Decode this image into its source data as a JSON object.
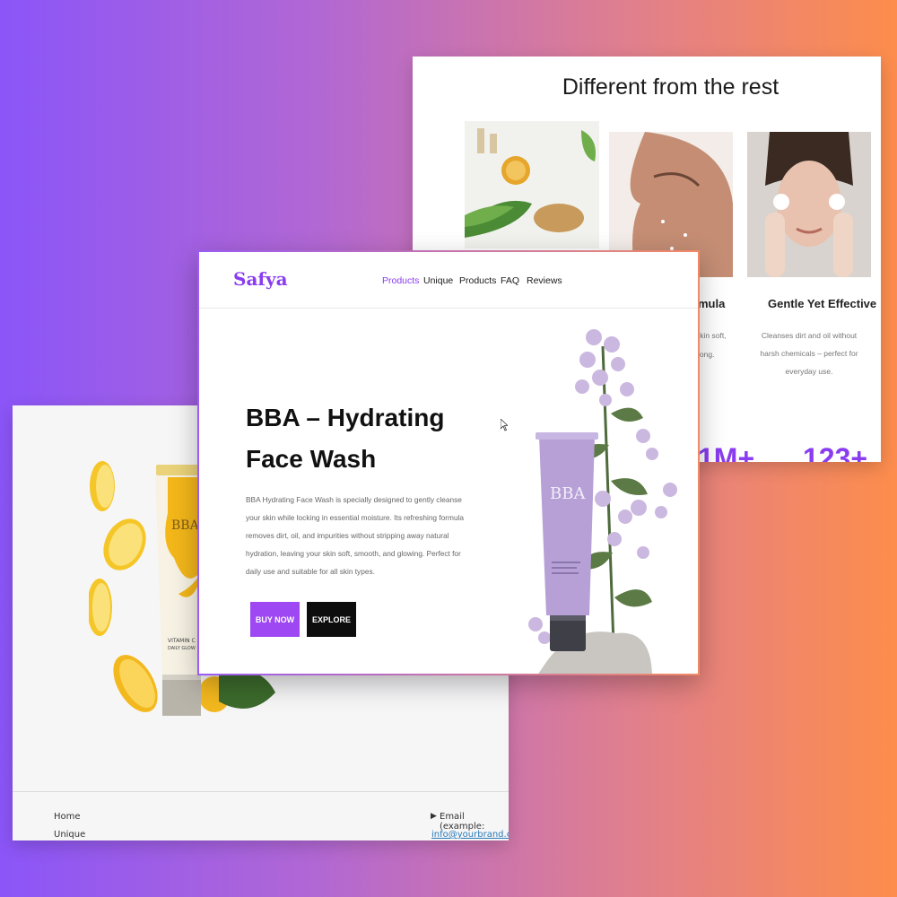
{
  "colors": {
    "background_gradient": [
      "#8b55f8",
      "#b167d4",
      "#e07f8e",
      "#fd8d4c"
    ],
    "brand_purple": "#8a3df0",
    "button_buy": "#9d48f2",
    "button_explore": "#0d0d0d"
  },
  "left_page": {
    "product_image": "vitamin-c-lemon-tube",
    "footer": {
      "links": [
        "Home",
        "Unique"
      ],
      "email_label": "Email (example:",
      "email_link": "info@yourbrand.com)"
    }
  },
  "right_page": {
    "title": "Different from the rest",
    "features": [
      {
        "image": "natural-ingredients-photo"
      },
      {
        "image": "dewy-skin-photo",
        "title_fragment": "mula",
        "desc_fragments": [
          "skin soft,",
          "long."
        ]
      },
      {
        "image": "cleansing-face-photo",
        "title": "Gentle Yet Effective",
        "desc": "Cleanses dirt and oil without harsh chemicals – perfect for everyday use."
      }
    ],
    "stats": [
      "1M+",
      "123+"
    ]
  },
  "main_page": {
    "brand": "Safya",
    "nav": [
      {
        "label": "Products",
        "active": true
      },
      {
        "label": "Unique",
        "active": false
      },
      {
        "label": "Products",
        "active": false
      },
      {
        "label": "FAQ",
        "active": false
      },
      {
        "label": "Reviews",
        "active": false
      }
    ],
    "hero": {
      "title": "BBA – Hydrating Face Wash",
      "description": "BBA Hydrating Face Wash is specially designed to gently cleanse your skin while locking in essential moisture. Its refreshing formula removes dirt, oil, and impurities without stripping away natural hydration, leaving your skin soft, smooth, and glowing. Perfect for daily use and suitable for all skin types.",
      "buy_label": "BUY NOW",
      "explore_label": "EXPLORE"
    },
    "product_image": "bba-face-wash-tube-with-flowers",
    "tube_text": "BBA"
  }
}
